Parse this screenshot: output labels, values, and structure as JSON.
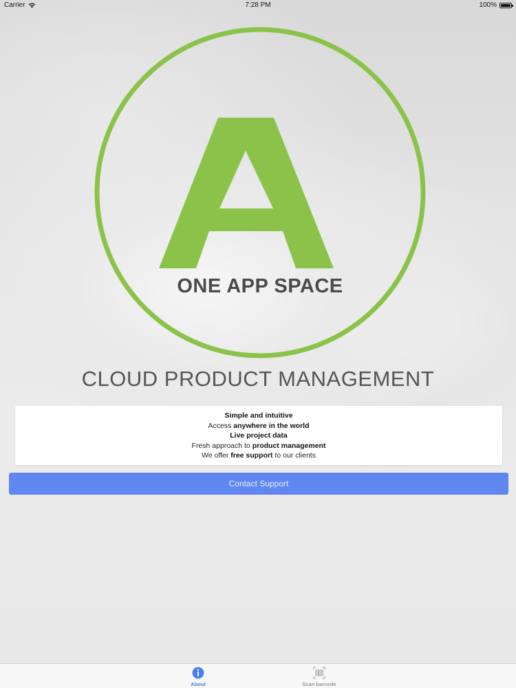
{
  "status_bar": {
    "carrier": "Carrier",
    "time": "7:28 PM",
    "battery": "100%"
  },
  "logo": {
    "letter": "A",
    "name": "ONE APP SPACE",
    "color": "#8bc34a"
  },
  "subtitle": "CLOUD PRODUCT MANAGEMENT",
  "features": [
    {
      "pre": "",
      "bold": "Simple and intuitive",
      "post": ""
    },
    {
      "pre": "Access ",
      "bold": "anywhere in the world",
      "post": ""
    },
    {
      "pre": "",
      "bold": "Live project data",
      "post": ""
    },
    {
      "pre": "Fresh approach to ",
      "bold": "product management",
      "post": ""
    },
    {
      "pre": "We offer ",
      "bold": "free support",
      "post": " to our clients"
    }
  ],
  "contact_button": {
    "label": "Contact Support",
    "color": "#6087f0"
  },
  "tabs": [
    {
      "label": "About",
      "icon": "info-icon",
      "active": true
    },
    {
      "label": "Scan barcode",
      "icon": "barcode-icon",
      "active": false
    }
  ],
  "colors": {
    "accent": "#4a7ff0",
    "logo_green": "#8bc34a",
    "text_dark": "#4a4a4a"
  }
}
